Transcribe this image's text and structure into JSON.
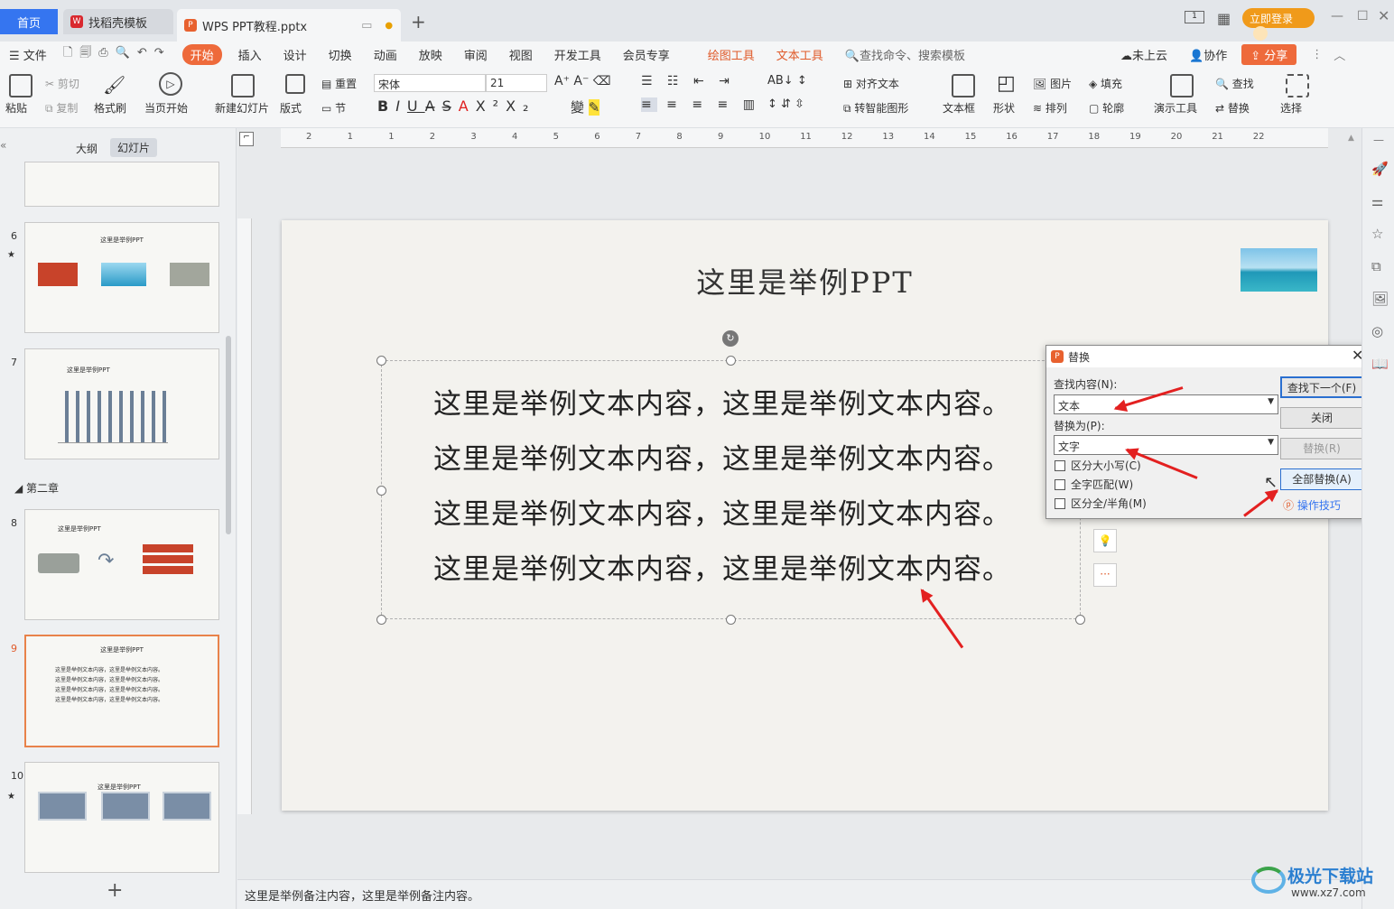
{
  "tabs": {
    "home": "首页",
    "daoke": "找稻壳模板",
    "file": "WPS PPT教程.pptx",
    "add": "+"
  },
  "titlebar": {
    "login": "立即登录"
  },
  "menu": {
    "file": "文件",
    "items": [
      "开始",
      "插入",
      "设计",
      "切换",
      "动画",
      "放映",
      "审阅",
      "视图",
      "开发工具",
      "会员专享"
    ],
    "draw": "绘图工具",
    "text": "文本工具",
    "search": "查找命令、搜索模板",
    "cloud": "未上云",
    "collab": "协作",
    "share": "分享"
  },
  "ribbon": {
    "paste": "粘贴",
    "cut": "剪切",
    "copy": "复制",
    "format_painter": "格式刷",
    "from_current": "当页开始",
    "new_slide": "新建幻灯片",
    "layout": "版式",
    "reset": "重置",
    "section": "节",
    "font": "宋体",
    "size": "21",
    "align_text": "对齐文本",
    "smartart": "转智能图形",
    "textbox": "文本框",
    "shape": "形状",
    "picture": "图片",
    "fill": "填充",
    "arrange": "排列",
    "outline": "轮廓",
    "present": "演示工具",
    "find": "查找",
    "replace": "替换",
    "select": "选择"
  },
  "panel": {
    "outline_tab": "大纲",
    "slides_tab": "幻灯片",
    "chapter": "第二章",
    "numbers": [
      "6",
      "7",
      "8",
      "9",
      "10"
    ],
    "slide_title": "这里是举例PPT",
    "add": "+"
  },
  "slide": {
    "title": "这里是举例PPT",
    "lines": [
      "这里是举例文本内容，这里是举例文本内容。",
      "这里是举例文本内容，这里是举例文本内容。",
      "这里是举例文本内容，这里是举例文本内容。",
      "这里是举例文本内容，这里是举例文本内容。"
    ]
  },
  "dialog": {
    "title": "替换",
    "find_label": "查找内容(N):",
    "find_value": "文本",
    "replace_label": "替换为(P):",
    "replace_value": "文字",
    "case": "区分大小写(C)",
    "whole": "全字匹配(W)",
    "width": "区分全/半角(M)",
    "find_next": "查找下一个(F)",
    "close": "关闭",
    "replace": "替换(R)",
    "replace_all": "全部替换(A)",
    "tips": "操作技巧"
  },
  "notes": "这里是举例备注内容，这里是举例备注内容。",
  "ruler": [
    "2",
    "1",
    "1",
    "2",
    "3",
    "4",
    "5",
    "6",
    "7",
    "8",
    "9",
    "10",
    "11",
    "12",
    "13",
    "14",
    "15",
    "16",
    "17",
    "18",
    "19",
    "20",
    "21",
    "22"
  ],
  "watermark": {
    "name": "极光下载站",
    "url": "www.xz7.com"
  },
  "colors": {
    "accent": "#3575f0",
    "orange": "#ee6a3b",
    "arrow": "#e32020"
  }
}
